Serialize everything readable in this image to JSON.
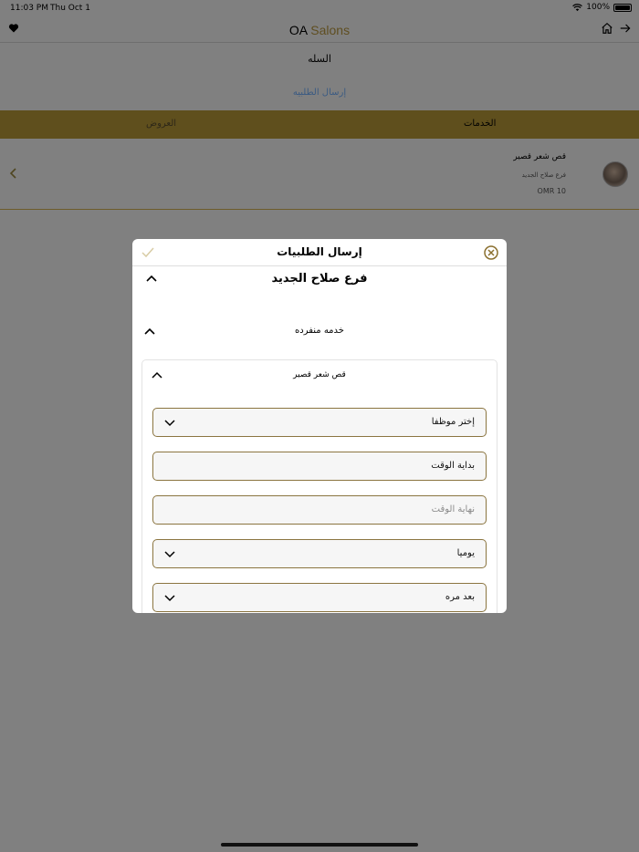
{
  "status_bar": {
    "time": "11:03 PM",
    "date": "Thu Oct 1",
    "battery": "100%"
  },
  "nav": {
    "title_oa": "OA",
    "title_salons": "Salons",
    "brand_color": "#8a6f2e"
  },
  "cart": {
    "title": "السله",
    "send_link": "إرسال الطلبيه",
    "tabs": {
      "services": "الخدمات",
      "offers": "العروض"
    },
    "item": {
      "name": "قص شعر قصير",
      "branch": "فرع صلاح الجديد",
      "price": "OMR 10"
    }
  },
  "modal": {
    "title": "إرسال الطلبيات",
    "branch_title": "فرع صلاح الجديد",
    "single_service_title": "خدمه منفرده",
    "service_title": "قص شعر قصير",
    "fields": {
      "employee": "إختر موظفا",
      "start_time": "بداية الوقت",
      "end_time": "نهاية الوقت",
      "frequency": "يوميا",
      "repeat": "بعد مره"
    }
  }
}
